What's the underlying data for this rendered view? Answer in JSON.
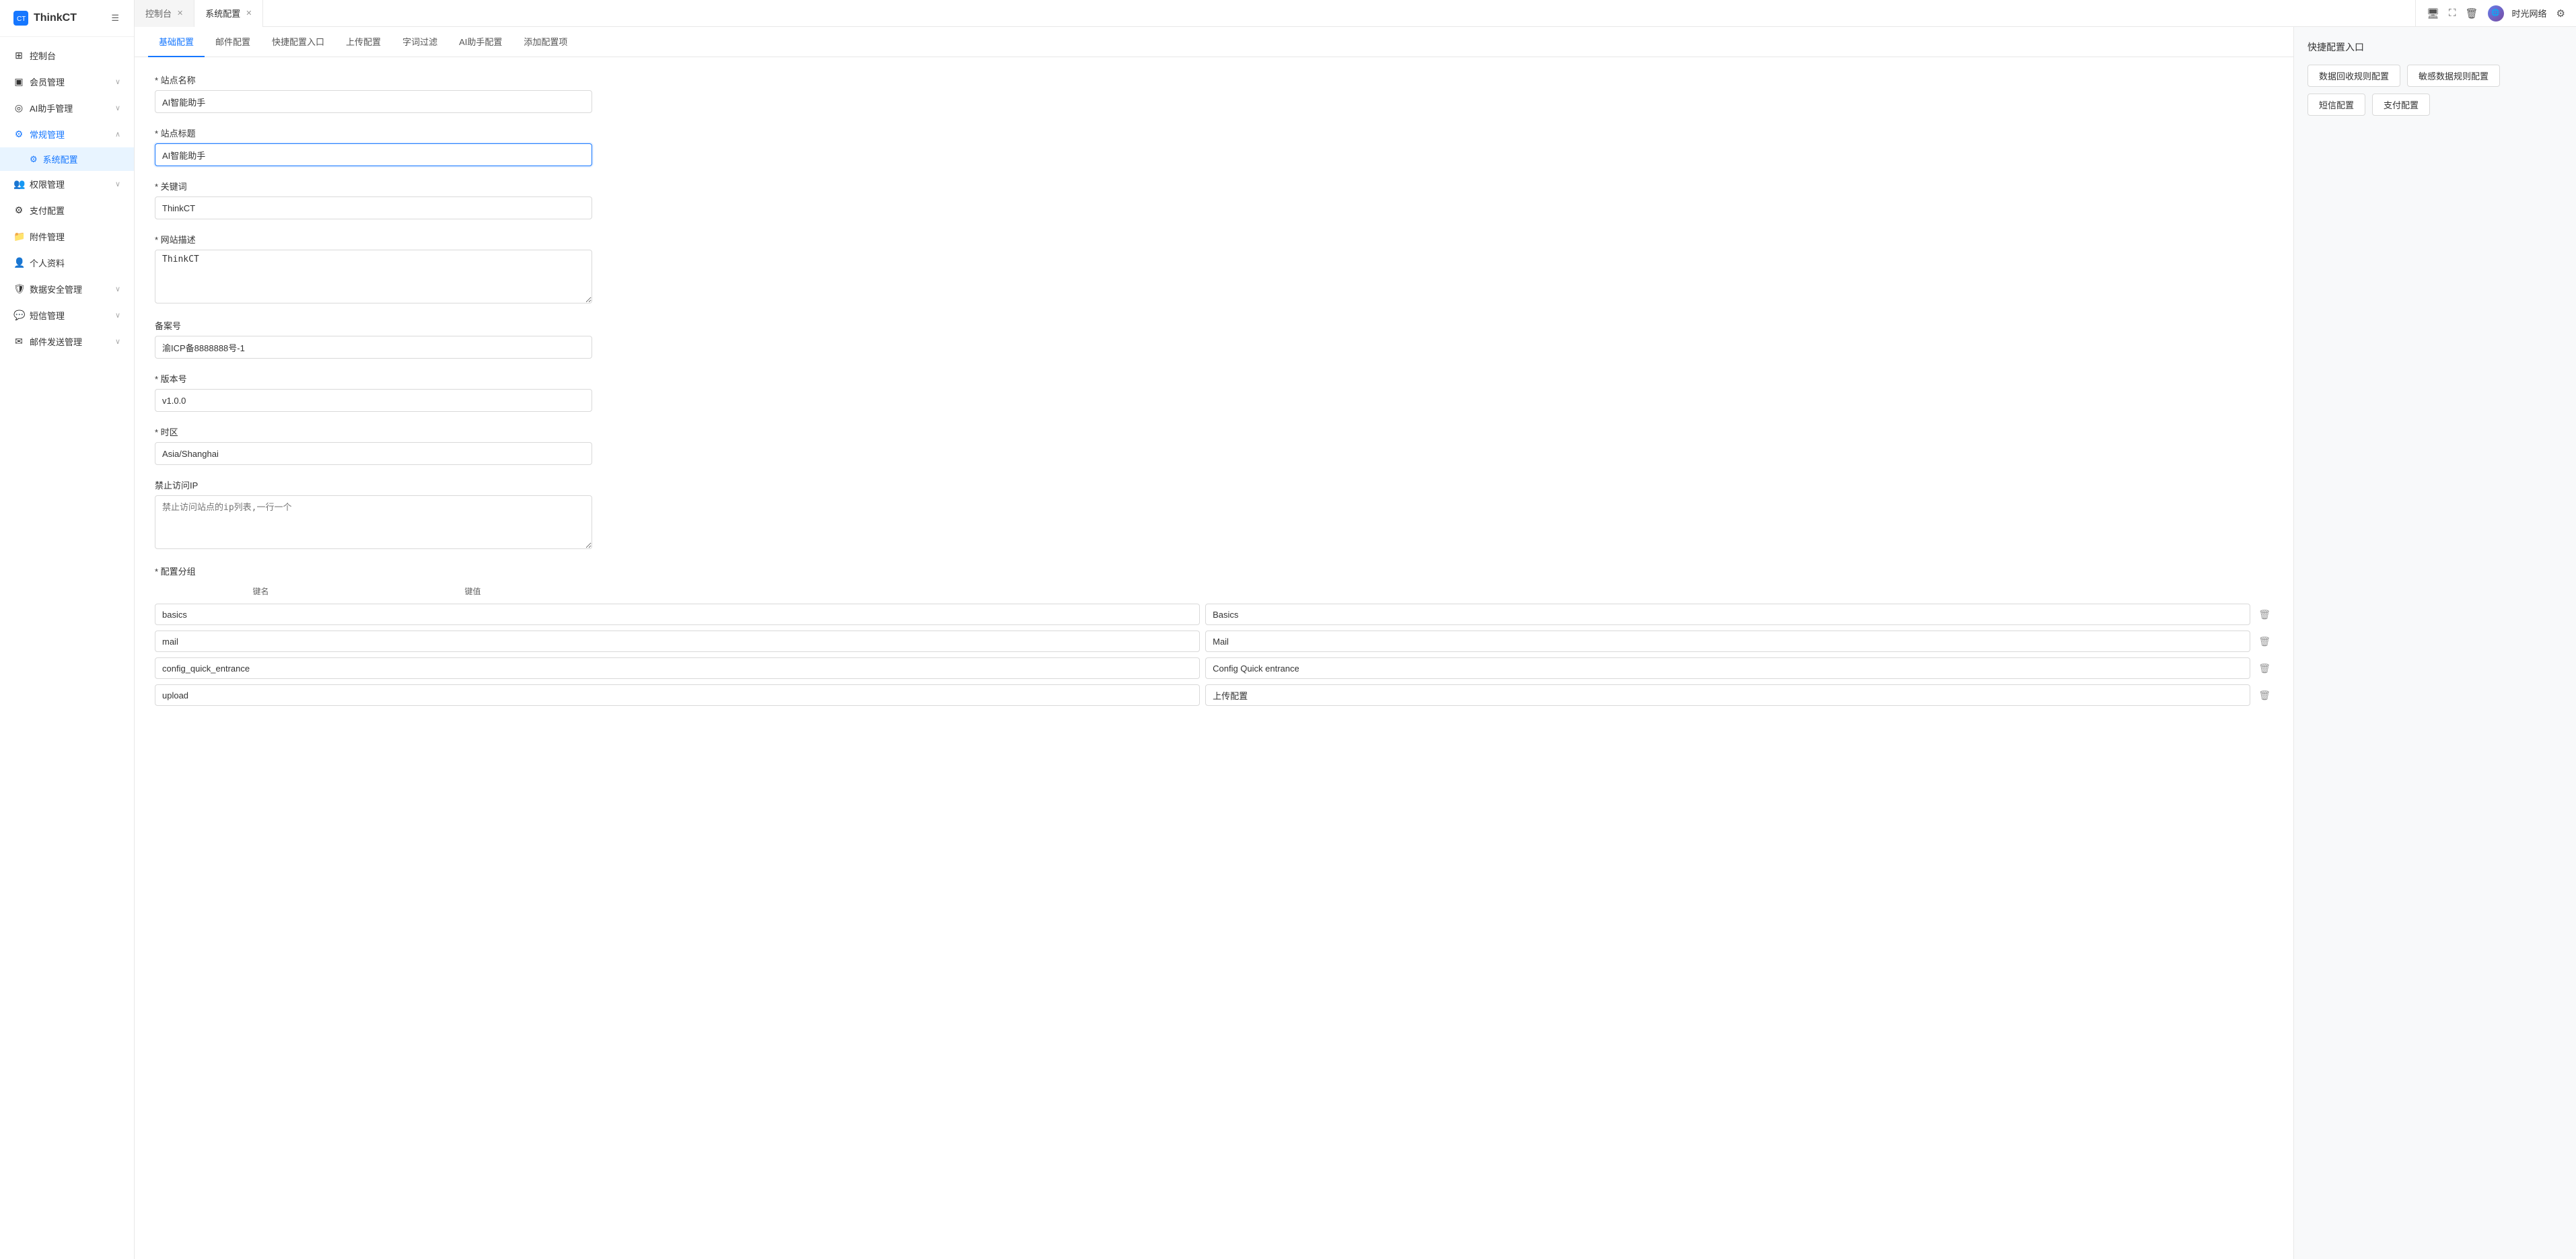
{
  "app": {
    "logo_text": "ThinkCT",
    "logo_icon": "CT"
  },
  "tabs": [
    {
      "id": "dashboard",
      "label": "控制台",
      "closable": true
    },
    {
      "id": "system_config",
      "label": "系统配置",
      "closable": true,
      "active": true
    }
  ],
  "topright": {
    "monitor_icon": "🖥",
    "expand_icon": "⛶",
    "delete_icon": "🗑",
    "user_name": "时光网络",
    "settings_icon": "⚙"
  },
  "sidebar": {
    "items": [
      {
        "id": "dashboard",
        "icon": "⊞",
        "label": "控制台",
        "has_children": false
      },
      {
        "id": "member",
        "icon": "▣",
        "label": "会员管理",
        "has_children": true
      },
      {
        "id": "ai_assistant",
        "icon": "◎",
        "label": "AI助手管理",
        "has_children": true
      },
      {
        "id": "general",
        "icon": "⚙",
        "label": "常规管理",
        "has_children": true,
        "expanded": true
      },
      {
        "id": "permission",
        "icon": "👥",
        "label": "权限管理",
        "has_children": true
      },
      {
        "id": "payment",
        "icon": "⚙",
        "label": "支付配置",
        "has_children": false
      },
      {
        "id": "attachment",
        "icon": "📁",
        "label": "附件管理",
        "has_children": false
      },
      {
        "id": "profile",
        "icon": "👤",
        "label": "个人资料",
        "has_children": false
      },
      {
        "id": "data_security",
        "icon": "🛡",
        "label": "数据安全管理",
        "has_children": true
      },
      {
        "id": "sms",
        "icon": "💬",
        "label": "短信管理",
        "has_children": true
      },
      {
        "id": "email",
        "icon": "✉",
        "label": "邮件发送管理",
        "has_children": true
      }
    ],
    "sub_items": [
      {
        "id": "system_config",
        "label": "系统配置",
        "active": true
      }
    ]
  },
  "sub_tabs": [
    {
      "id": "basic_config",
      "label": "基础配置",
      "active": true
    },
    {
      "id": "email_config",
      "label": "邮件配置"
    },
    {
      "id": "quick_config",
      "label": "快捷配置入口"
    },
    {
      "id": "upload_config",
      "label": "上传配置"
    },
    {
      "id": "word_filter",
      "label": "字词过滤"
    },
    {
      "id": "ai_config",
      "label": "AI助手配置"
    },
    {
      "id": "add_config",
      "label": "添加配置项"
    }
  ],
  "form": {
    "site_name_label": "* 站点名称",
    "site_name_value": "AI智能助手",
    "site_title_label": "* 站点标题",
    "site_title_value": "AI智能助手",
    "keywords_label": "* 关键词",
    "keywords_value": "ThinkCT",
    "site_desc_label": "* 网站描述",
    "site_desc_value": "ThinkCT",
    "icp_label": "备案号",
    "icp_value": "渝ICP备8888888号-1",
    "version_label": "* 版本号",
    "version_value": "v1.0.0",
    "timezone_label": "* 时区",
    "timezone_value": "Asia/Shanghai",
    "banned_ip_label": "禁止访问IP",
    "banned_ip_placeholder": "禁止访问站点的ip列表,一行一个",
    "config_group_label": "* 配置分组",
    "table_header_key": "键名",
    "table_header_value": "键值",
    "config_rows": [
      {
        "key": "basics",
        "value": "Basics"
      },
      {
        "key": "mail",
        "value": "Mail"
      },
      {
        "key": "config_quick_entrance",
        "value": "Config Quick entrance"
      },
      {
        "key": "upload",
        "value": "上传配置"
      }
    ]
  },
  "right_panel": {
    "title": "快捷配置入口",
    "buttons": [
      {
        "id": "data_collection",
        "label": "数据回收规则配置"
      },
      {
        "id": "sensitive_data",
        "label": "敏感数据规则配置"
      },
      {
        "id": "sms_config",
        "label": "短信配置"
      },
      {
        "id": "payment_config",
        "label": "支付配置"
      }
    ]
  }
}
